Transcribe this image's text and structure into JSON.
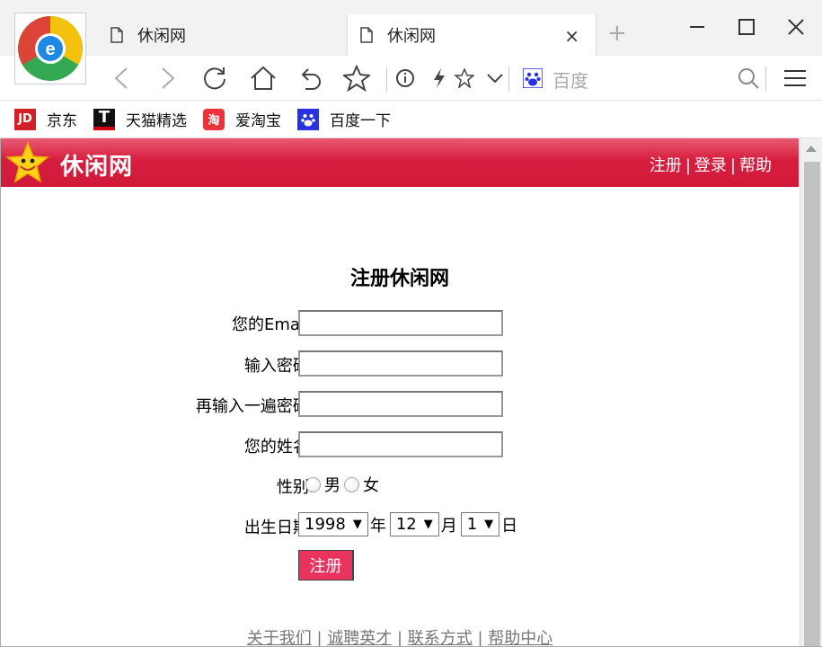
{
  "browser": {
    "tabs": [
      {
        "label": "休闲网"
      },
      {
        "label": "休闲网"
      }
    ],
    "close_tab": "×",
    "new_tab": "+",
    "search_engine_label": "百度",
    "bookmarks": [
      {
        "label": "京东",
        "icon_text": "JD",
        "color": "#d31f26"
      },
      {
        "label": "天猫精选",
        "icon_text": "T",
        "color": "#d10012"
      },
      {
        "label": "爱淘宝",
        "icon_text": "淘",
        "color": "#e8343a"
      },
      {
        "label": "百度一下",
        "icon_text": "",
        "color": "#2932e1"
      }
    ]
  },
  "site": {
    "name": "休闲网",
    "nav": [
      "注册",
      "登录",
      "帮助"
    ],
    "header_color": "#d11a3a"
  },
  "form": {
    "title": "注册休闲网",
    "email_label": "您的Email:",
    "password_label": "输入密码:",
    "confirm_label": "再输入一遍密码:",
    "name_label": "您的姓名:",
    "gender_label": "性别:",
    "gender_options": [
      "男",
      "女"
    ],
    "dob_label": "出生日期:",
    "dob_year": "1998",
    "dob_year_unit": "年",
    "dob_month": "12",
    "dob_month_unit": "月",
    "dob_day": "1",
    "dob_day_unit": "日",
    "submit_label": "注册",
    "submit_color": "#e8335f"
  },
  "footer": {
    "links": [
      "关于我们",
      "诚聘英才",
      "联系方式",
      "帮助中心"
    ]
  }
}
